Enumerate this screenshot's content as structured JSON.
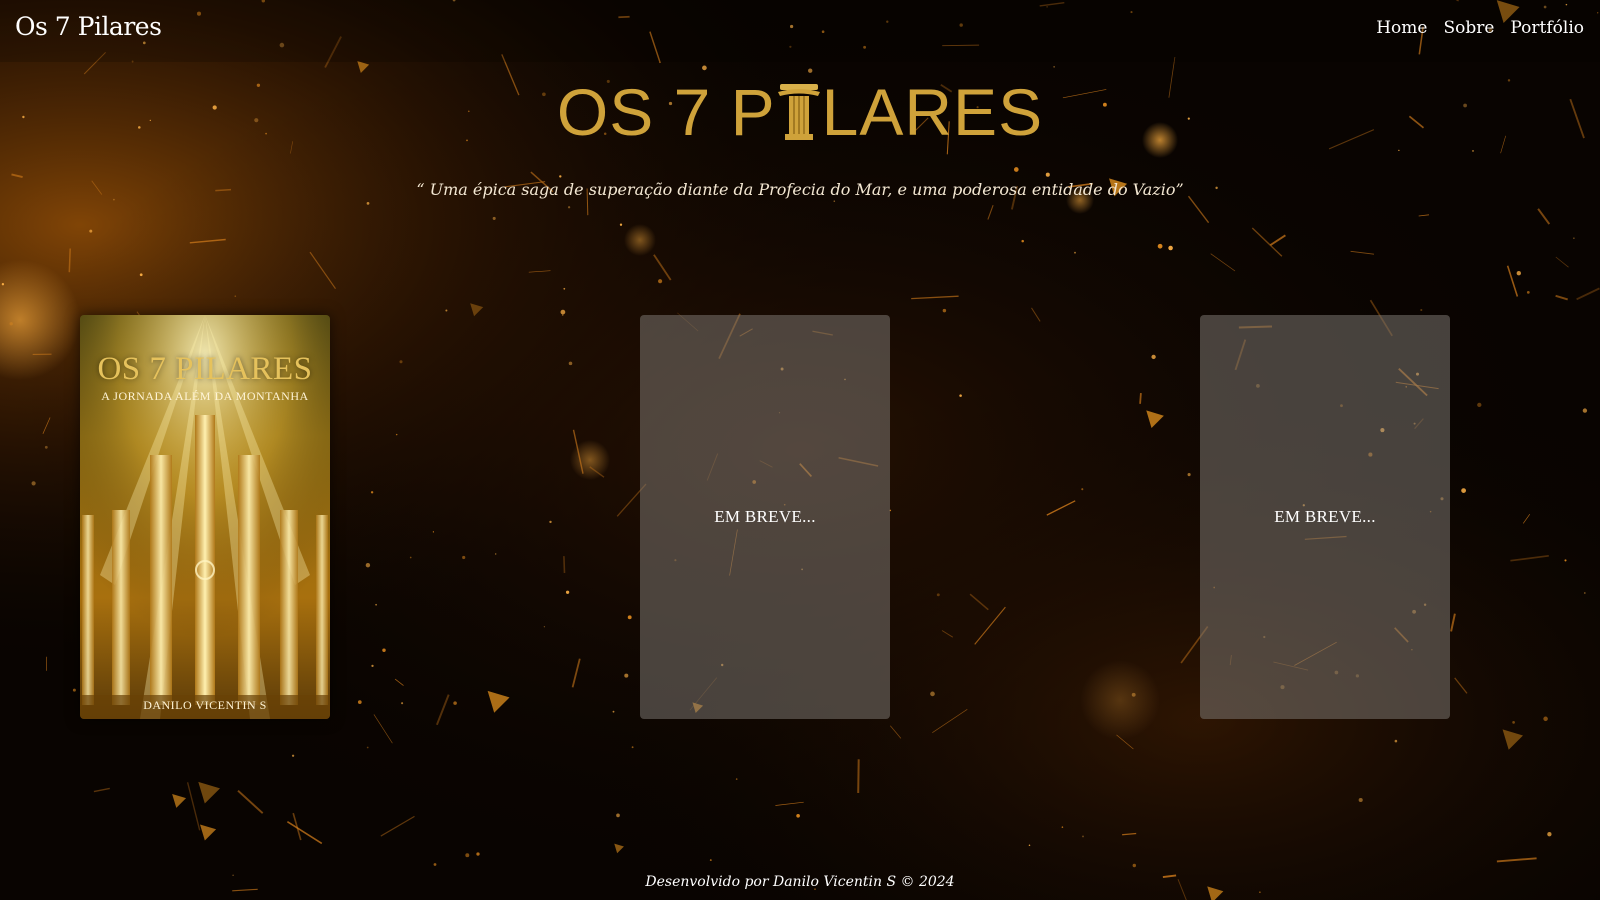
{
  "header": {
    "brand": "Os 7 Pilares",
    "nav": [
      "Home",
      "Sobre",
      "Portfólio"
    ]
  },
  "hero": {
    "logo_before": "OS 7 P",
    "logo_after": "LARES",
    "tagline": "“ Uma épica saga de superação diante da Profecia do Mar, e uma poderosa entidade do Vazio”"
  },
  "books": {
    "cover": {
      "title": "OS 7 PILARES",
      "subtitle": "A JORNADA ALÉM DA MONTANHA",
      "author": "DANILO VICENTIN S"
    },
    "soon_1": "EM BREVE...",
    "soon_2": "EM BREVE..."
  },
  "footer": {
    "credit": "Desenvolvido por Danilo Vicentin S © 2024"
  },
  "colors": {
    "background": "#090401",
    "accent_gold": "#cfa23a",
    "ember_orange": "#e08a1e",
    "soon_card": "#7a7470"
  },
  "icons": {
    "logo_i": "pillar-icon"
  }
}
